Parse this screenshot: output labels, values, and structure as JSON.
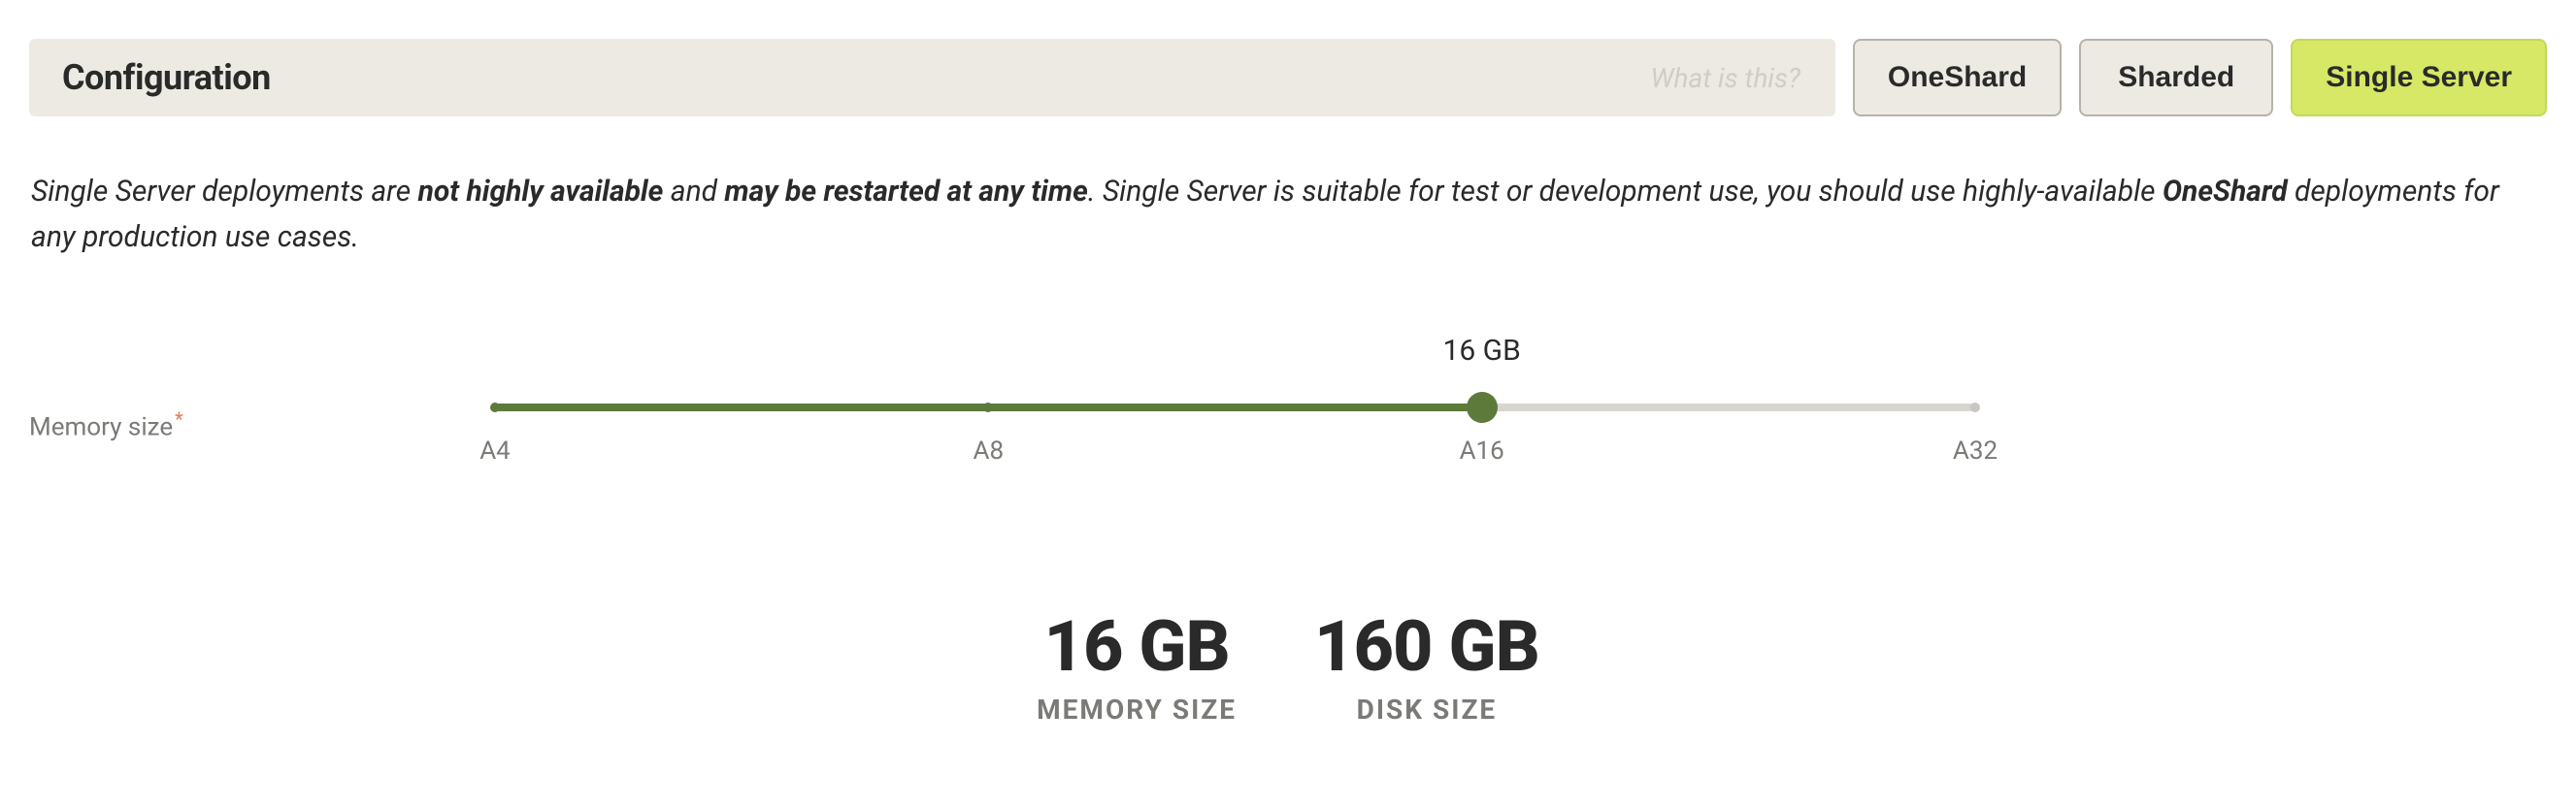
{
  "header": {
    "title": "Configuration",
    "help_link": "What is this?",
    "tabs": {
      "oneshard": "OneShard",
      "sharded": "Sharded",
      "single_server": "Single Server"
    }
  },
  "description": {
    "part1": "Single Server deployments are ",
    "bold1": "not highly available",
    "part2": " and ",
    "bold2": "may be restarted at any time",
    "part3": ". Single Server is suitable for test or development use, you should use highly-available ",
    "bold3": "OneShard",
    "part4": " deployments for any production use cases."
  },
  "slider": {
    "label": "Memory size",
    "required_marker": "*",
    "value_label": "16 GB",
    "ticks": [
      "A4",
      "A8",
      "A16",
      "A32"
    ],
    "selected_index": 2,
    "percent": 66.6667
  },
  "stats": {
    "memory_value": "16 GB",
    "memory_label": "MEMORY SIZE",
    "disk_value": "160 GB",
    "disk_label": "DISK SIZE"
  }
}
